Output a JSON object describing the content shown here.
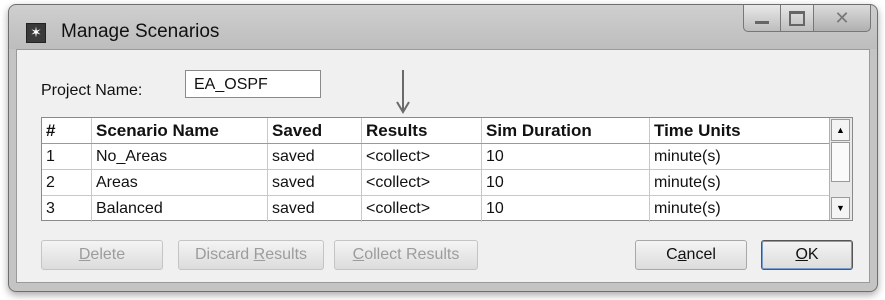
{
  "window": {
    "title": "Manage Scenarios",
    "buttons": {
      "minimize": "minimize",
      "maximize": "maximize",
      "close": "close"
    }
  },
  "project": {
    "label": "Project Name:",
    "value": "EA_OSPF"
  },
  "table": {
    "columns": [
      "#",
      "Scenario Name",
      "Saved",
      "Results",
      "Sim Duration",
      "Time Units"
    ],
    "rows": [
      [
        "1",
        "No_Areas",
        "saved",
        "<collect>",
        "10",
        "minute(s)"
      ],
      [
        "2",
        "Areas",
        "saved",
        "<collect>",
        "10",
        "minute(s)"
      ],
      [
        "3",
        "Balanced",
        "saved",
        "<collect>",
        "10",
        "minute(s)"
      ]
    ]
  },
  "buttons": {
    "delete": {
      "pre": "",
      "ul": "D",
      "post": "elete"
    },
    "discard": {
      "pre": "Discard ",
      "ul": "R",
      "post": "esults"
    },
    "collect": {
      "pre": "",
      "ul": "C",
      "post": "ollect Results"
    },
    "cancel": {
      "pre": "C",
      "ul": "a",
      "post": "ncel"
    },
    "ok": {
      "pre": "",
      "ul": "O",
      "post": "K"
    }
  },
  "icons": {
    "app": "app-icon",
    "annotation_arrow": "down-arrow-icon",
    "scroll_up": "scroll-up-icon",
    "scroll_down": "scroll-down-icon"
  }
}
